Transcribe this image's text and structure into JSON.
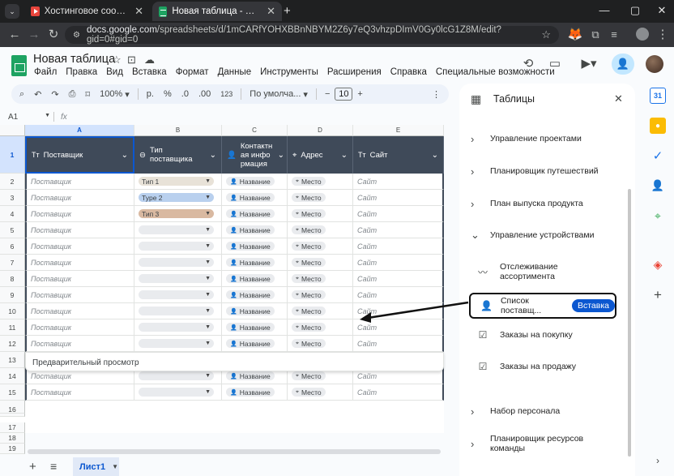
{
  "browser": {
    "tabs": [
      {
        "title": "Хостинговое сообщество «Tim",
        "active": false
      },
      {
        "title": "Новая таблица - Google Табли",
        "active": true
      }
    ],
    "url_host": "docs.google.com",
    "url_path": "/spreadsheets/d/1mCARfYOHXBBnNBYM2Z6y7eQ3vhzpDImV0Gy0lcG1Z8M/edit?gid=0#gid=0"
  },
  "doc": {
    "title": "Новая таблица",
    "menus": [
      "Файл",
      "Правка",
      "Вид",
      "Вставка",
      "Формат",
      "Данные",
      "Инструменты",
      "Расширения",
      "Справка",
      "Специальные возможности"
    ]
  },
  "toolbar": {
    "zoom": "100%",
    "currency": "р.",
    "percent": "%",
    "dec_dec": ".0",
    "dec_inc": ".00",
    "numfmt": "123",
    "font": "По умолча...",
    "font_size": "10"
  },
  "formula": {
    "cell_ref": "A1",
    "fx": "fx"
  },
  "grid": {
    "columns": [
      "A",
      "B",
      "C",
      "D",
      "E"
    ],
    "headers": [
      {
        "label": "Поставщик",
        "icon": "Тт"
      },
      {
        "label": "Тип поставщика",
        "icon": "◯"
      },
      {
        "label": "Контактная информация",
        "icon": "person"
      },
      {
        "label": "Адрес",
        "icon": "pin"
      },
      {
        "label": "Сайт",
        "icon": "Тт"
      }
    ],
    "row_numbers": [
      "1",
      "2",
      "3",
      "4",
      "5",
      "6",
      "7",
      "8",
      "9",
      "10",
      "11",
      "12",
      "13",
      "14",
      "15",
      "16",
      "17",
      "18",
      "19"
    ],
    "data_rows": [
      {
        "a": "Поставщик",
        "b": "Тип 1",
        "b_color": "#e8e2d8",
        "c": "Название",
        "d": "Место",
        "e": "Сайт"
      },
      {
        "a": "Поставщик",
        "b": "Type 2",
        "b_color": "#b9d0ee",
        "c": "Название",
        "d": "Место",
        "e": "Сайт"
      },
      {
        "a": "Поставщик",
        "b": "Тип 3",
        "b_color": "#d9b9a1",
        "c": "Название",
        "d": "Место",
        "e": "Сайт"
      },
      {
        "a": "Поставщик",
        "b": "",
        "b_color": "#e9ebee",
        "c": "Название",
        "d": "Место",
        "e": "Сайт"
      },
      {
        "a": "Поставщик",
        "b": "",
        "b_color": "#e9ebee",
        "c": "Название",
        "d": "Место",
        "e": "Сайт"
      },
      {
        "a": "Поставщик",
        "b": "",
        "b_color": "#e9ebee",
        "c": "Название",
        "d": "Место",
        "e": "Сайт"
      },
      {
        "a": "Поставщик",
        "b": "",
        "b_color": "#e9ebee",
        "c": "Название",
        "d": "Место",
        "e": "Сайт"
      },
      {
        "a": "Поставщик",
        "b": "",
        "b_color": "#e9ebee",
        "c": "Название",
        "d": "Место",
        "e": "Сайт"
      },
      {
        "a": "Поставщик",
        "b": "",
        "b_color": "#e9ebee",
        "c": "Название",
        "d": "Место",
        "e": "Сайт"
      },
      {
        "a": "Поставщик",
        "b": "",
        "b_color": "#e9ebee",
        "c": "Название",
        "d": "Место",
        "e": "Сайт"
      },
      {
        "a": "Поставщик",
        "b": "",
        "b_color": "#e9ebee",
        "c": "Название",
        "d": "Место",
        "e": "Сайт"
      },
      {
        "a": "Поставщик",
        "b": "",
        "b_color": "#e9ebee",
        "c": "Название",
        "d": "Место",
        "e": "Сайт"
      },
      {
        "a": "Поставщик",
        "b": "",
        "b_color": "#e9ebee",
        "c": "Название",
        "d": "Место",
        "e": "Сайт"
      },
      {
        "a": "Поставщик",
        "b": "",
        "b_color": "#e9ebee",
        "c": "Название",
        "d": "Место",
        "e": "Сайт"
      }
    ],
    "preview_label": "Предварительный просмотр"
  },
  "sheet": {
    "tab_label": "Лист1"
  },
  "panel": {
    "title": "Таблицы",
    "groups": [
      "Управление проектами",
      "Планировщик путешествий",
      "План выпуска продукта",
      "Управление устройствами"
    ],
    "sub_items": [
      {
        "label": "Отслеживание ассортимента",
        "icon": "trend-icon"
      },
      {
        "label": "Список поставщ...",
        "icon": "person-icon"
      },
      {
        "label": "Заказы на покупку",
        "icon": "checklist-icon"
      },
      {
        "label": "Заказы на продажу",
        "icon": "checklist-icon"
      }
    ],
    "insert_label": "Вставка",
    "groups_bottom": [
      "Набор персонала",
      "Планировщик ресурсов команды"
    ]
  },
  "colors": {
    "header_bg": "#3f4a59",
    "accent": "#0b57d0",
    "annotation_arrow": "#111111"
  }
}
